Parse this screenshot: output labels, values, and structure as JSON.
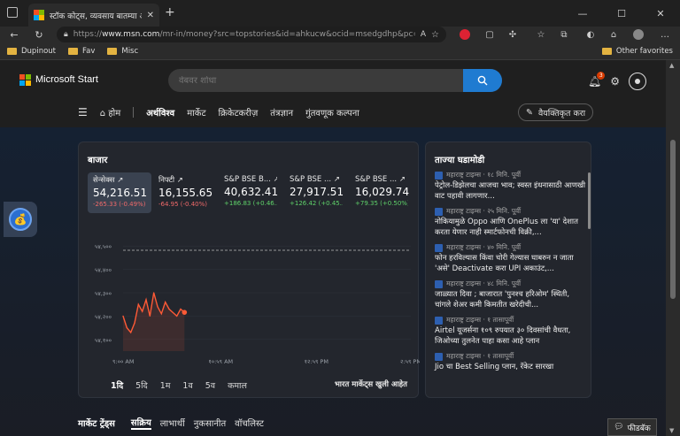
{
  "browser": {
    "tab_title": "स्टॉक कोट्स, व्यवसाय बातम्या आणि",
    "url_prefix": "https://",
    "url_host": "www.msn.com",
    "url_rest": "/mr-in/money?src=topstories&id=ahkucw&ocid=msedgdhp&pc=U53...",
    "favorites": [
      "Dupinout",
      "Fav",
      "Misc"
    ],
    "other_favorites": "Other favorites"
  },
  "header": {
    "logo": "Microsoft Start",
    "search_placeholder": "वेबवर शोधा",
    "nav": [
      "होम",
      "अर्थविश्व",
      "मार्केट",
      "क्रिकेटकरीज़",
      "तंत्रज्ञान",
      "गुंतवणूक कल्पना"
    ],
    "personalize": "वैयक्तिकृत करा",
    "notification_count": "3"
  },
  "market": {
    "title": "बाजार",
    "tickers": [
      {
        "name": "सेन्सेक्स",
        "value": "54,216.51",
        "change": "-265.33 (-0.49%)",
        "dir": "neg"
      },
      {
        "name": "निफ्टी",
        "value": "16,155.65",
        "change": "-64.95 (-0.40%)",
        "dir": "neg"
      },
      {
        "name": "S&P BSE B...",
        "value": "40,632.41",
        "change": "+186.83 (+0.46...",
        "dir": "pos"
      },
      {
        "name": "S&P BSE ...",
        "value": "27,917.51",
        "change": "+126.42 (+0.45...",
        "dir": "pos"
      },
      {
        "name": "S&P BSE ...",
        "value": "16,029.74",
        "change": "+79.35 (+0.50%)",
        "dir": "pos"
      }
    ],
    "ranges": [
      "1दि",
      "5दि",
      "1म",
      "1व",
      "5व",
      "कमाल"
    ],
    "status": "भारत मार्केट्स खुली आहेत"
  },
  "chart_data": {
    "type": "line",
    "yticks": [
      "५४,५००",
      "५४,४००",
      "५४,३००",
      "५४,२००",
      "५४,१००"
    ],
    "yvalues": [
      54500,
      54400,
      54300,
      54200,
      54100
    ],
    "xticks": [
      "९:०० AM",
      "१०:५९ AM",
      "१२:५९ PM",
      "२:५९ PM"
    ],
    "previous_close": 54481.84,
    "x": [
      "9:15",
      "9:20",
      "9:25",
      "9:30",
      "9:35",
      "9:40",
      "9:45",
      "9:50",
      "9:55",
      "10:00",
      "10:05",
      "10:10",
      "10:15",
      "10:20",
      "10:25",
      "10:30",
      "10:35"
    ],
    "values": [
      54200,
      54150,
      54130,
      54170,
      54250,
      54220,
      54270,
      54200,
      54300,
      54240,
      54210,
      54260,
      54230,
      54215,
      54200,
      54230,
      54216
    ]
  },
  "news": {
    "title": "ताज्या घडामोडी",
    "items": [
      {
        "source": "महाराष्ट्र टाइम्स · १८ मिनि. पूर्वी",
        "headline": "पेट्रोल-डिझेलचा आजचा भाव; स्वस्त इंधनासाठी आणखी वाट पहावी लागणार..."
      },
      {
        "source": "महाराष्ट्र टाइम्स · २५ मिनि. पूर्वी",
        "headline": "नोकियामुळे Oppo आणि OnePlus ला 'या' देशात करता येणार नाही स्मार्टफोनची विक्री,..."
      },
      {
        "source": "महाराष्ट्र टाइम्स · ४० मिनि. पूर्वी",
        "headline": "फोन हरविल्यास किंवा चोरी गेल्यास घाबरुन न जाता 'असे' Deactivate करा UPI अकाउंट,..."
      },
      {
        "source": "महाराष्ट्र टाइम्स · ४८ मिनि. पूर्वी",
        "headline": "जाळ्यात दिवा ; बाजारात 'पुनश्च हरिओम' स्थिती, चांगले शेअर कमी किमतीत खरेदीची..."
      },
      {
        "source": "महाराष्ट्र टाइम्स · १ तासापूर्वी",
        "headline": "Airtel यूजर्सना १०९ रुपयात ३० दिवसांची वैधता, जिओच्या तुलनेत पाहा कसा आहे प्लान"
      },
      {
        "source": "महाराष्ट्र टाइम्स · १ तासापूर्वी",
        "headline": "Jio चा Best Selling प्लान, रॅकेट सारखा"
      }
    ]
  },
  "trends": {
    "title": "मार्केट ट्रेंड्स",
    "tabs": [
      "सक्रिय",
      "लाभार्थी",
      "नुकसानीत",
      "वॉचलिस्ट"
    ]
  },
  "feedback": "फीडबॅक",
  "colors": {
    "accent": "#1f7bd1",
    "negative": "#f06a6a",
    "positive": "#5fd36a",
    "line": "#ff5a36"
  }
}
